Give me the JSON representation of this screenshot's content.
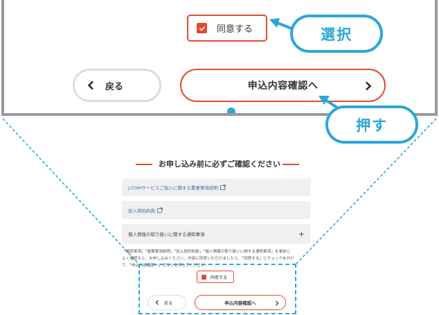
{
  "zoom": {
    "consent_label": "同意する",
    "back_label": "戻る",
    "proceed_label": "申込内容確認へ"
  },
  "callouts": {
    "select": "選択",
    "press": "押す"
  },
  "page": {
    "heading": "お申し込み前に必ずご確認ください",
    "accordion": [
      "J:COMサービスご加入に関する重要事項説明",
      "加入契約約款",
      "個人情報の取り扱いに関する通知事項"
    ],
    "notice_lines": [
      "「確認事項」「重要事項説明」「加入契約約款」「個人情報の取り扱いに関する通知事項」を事前に",
      "よく確認の上、お申し込みください。内容に同意いただけましたら、「同意する」にチェックを付け",
      "て、「申込内容確認へ」ボタンを押してください。"
    ],
    "consent_label": "同意する",
    "back_label": "戻る",
    "proceed_label": "申込内容確認へ"
  },
  "colors": {
    "accent": "#e2492c",
    "callout": "#2aa7d8",
    "frame": "#9a9a9a"
  }
}
